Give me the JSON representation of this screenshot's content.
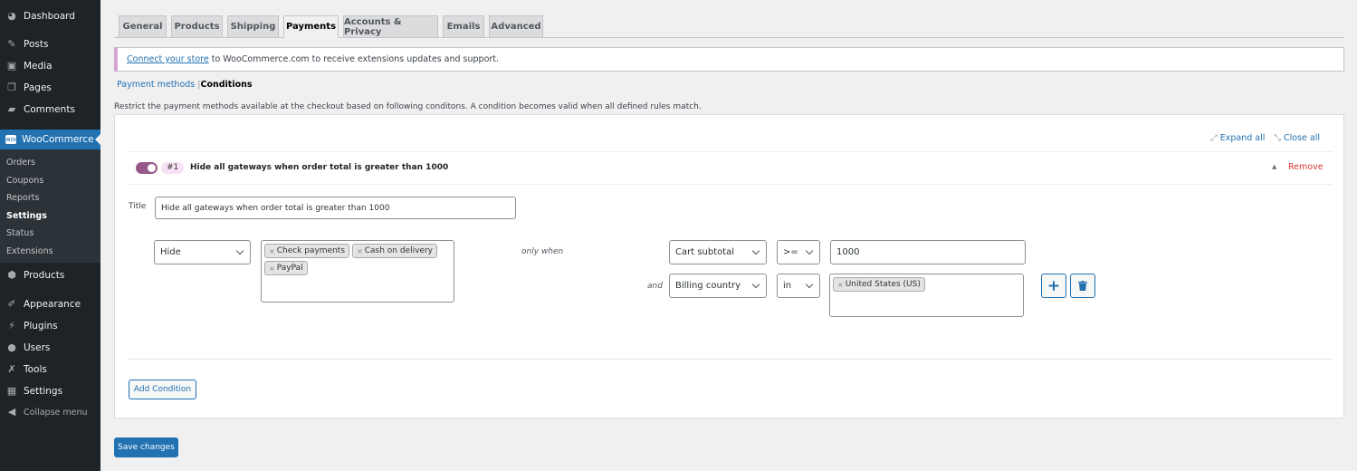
{
  "sidebar": {
    "items": [
      {
        "label": "Dashboard",
        "icon": "dashboard-icon"
      },
      {
        "label": "Posts",
        "icon": "pin-icon"
      },
      {
        "label": "Media",
        "icon": "media-icon"
      },
      {
        "label": "Pages",
        "icon": "pages-icon"
      },
      {
        "label": "Comments",
        "icon": "comment-icon"
      },
      {
        "label": "WooCommerce",
        "icon": "woo-icon"
      },
      {
        "label": "Products",
        "icon": "box-icon"
      },
      {
        "label": "Appearance",
        "icon": "brush-icon"
      },
      {
        "label": "Plugins",
        "icon": "plug-icon"
      },
      {
        "label": "Users",
        "icon": "user-icon"
      },
      {
        "label": "Tools",
        "icon": "wrench-icon"
      },
      {
        "label": "Settings",
        "icon": "settings-icon"
      },
      {
        "label": "Collapse menu",
        "icon": "collapse-icon"
      }
    ],
    "submenu": [
      "Orders",
      "Coupons",
      "Reports",
      "Settings",
      "Status",
      "Extensions"
    ],
    "submenu_current": "Settings"
  },
  "tabs": [
    "General",
    "Products",
    "Shipping",
    "Payments",
    "Accounts & Privacy",
    "Emails",
    "Advanced"
  ],
  "active_tab": "Payments",
  "notice": {
    "link": "Connect your store",
    "text": " to WooCommerce.com to receive extensions updates and support."
  },
  "subnav": {
    "link": "Payment methods",
    "sep": "|",
    "current": "Conditions"
  },
  "description": "Restrict the payment methods available at the checkout based on following conditons. A condition becomes valid when all defined rules match.",
  "panel": {
    "expand_all": "Expand all",
    "close_all": "Close all",
    "condition": {
      "enabled": true,
      "number": "#1",
      "heading": "Hide all gateways when order total is greater than 1000",
      "remove": "Remove",
      "title_label": "Title",
      "title_value": "Hide all gateways when order total is greater than 1000",
      "action": "Hide",
      "gateways": [
        "Check payments",
        "Cash on delivery",
        "PayPal"
      ],
      "only_when": "only when",
      "and": "and",
      "rules": [
        {
          "field": "Cart subtotal",
          "operator": ">=",
          "value": "1000"
        },
        {
          "field": "Billing country",
          "operator": "in",
          "values": [
            "United States (US)"
          ]
        }
      ]
    },
    "add_condition": "Add Condition"
  },
  "save": "Save changes",
  "colors": {
    "sidebar": "#1d2327",
    "accent": "#2271b1",
    "toggle": "#96588a",
    "remove": "#d63638"
  }
}
